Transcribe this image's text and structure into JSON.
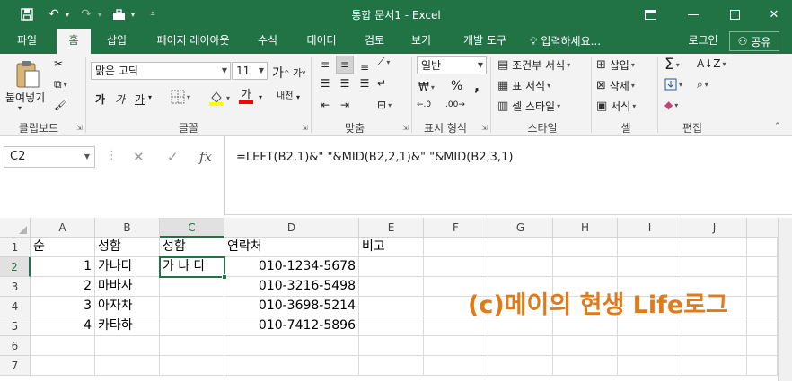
{
  "window": {
    "title": "통합 문서1 - Excel",
    "brand_color": "#217346"
  },
  "ribbon_tabs": [
    "파일",
    "홈",
    "삽입",
    "페이지 레이아웃",
    "수식",
    "데이터",
    "검토",
    "보기",
    "개발 도구"
  ],
  "active_tab": "홈",
  "tell_me": "입력하세요...",
  "account": {
    "signin": "로그인",
    "share": "공유"
  },
  "clipboard": {
    "paste": "붙여넣기",
    "group": "클립보드"
  },
  "font": {
    "name": "맑은 고딕",
    "size": "11",
    "bold": "가",
    "italic": "가",
    "underline": "가",
    "color_a": "가",
    "phonetic": "내천",
    "group": "글꼴"
  },
  "alignment": {
    "group": "맞춤"
  },
  "number": {
    "format": "일반",
    "group": "표시 형식"
  },
  "styles": {
    "conditional": "조건부 서식",
    "table": "표 서식",
    "cell": "셀 스타일",
    "group": "스타일"
  },
  "cells": {
    "insert": "삽입",
    "delete": "삭제",
    "format": "서식",
    "group": "셀"
  },
  "editing": {
    "group": "편집"
  },
  "formula_bar": {
    "name_box": "C2",
    "formula": "=LEFT(B2,1)&\" \"&MID(B2,2,1)&\" \"&MID(B2,3,1)"
  },
  "sheet": {
    "columns": [
      "A",
      "B",
      "C",
      "D",
      "E",
      "F",
      "G",
      "H",
      "I",
      "J"
    ],
    "selected_column": "C",
    "rows": [
      "1",
      "2",
      "3",
      "4",
      "5",
      "6",
      "7"
    ],
    "selected_row": "2",
    "cells": {
      "A1": "순",
      "B1": "성함",
      "C1": "성함",
      "D1": "연락처",
      "E1": "비고",
      "A2": "1",
      "B2": "가나다",
      "C2": "가 나 다",
      "D2": "010-1234-5678",
      "A3": "2",
      "B3": "마바사",
      "D3": "010-3216-5498",
      "A4": "3",
      "B4": "아자차",
      "D4": "010-3698-5214",
      "A5": "4",
      "B5": "카타하",
      "D5": "010-7412-5896"
    }
  },
  "watermark": "(c)메이의 현생 Life로그"
}
